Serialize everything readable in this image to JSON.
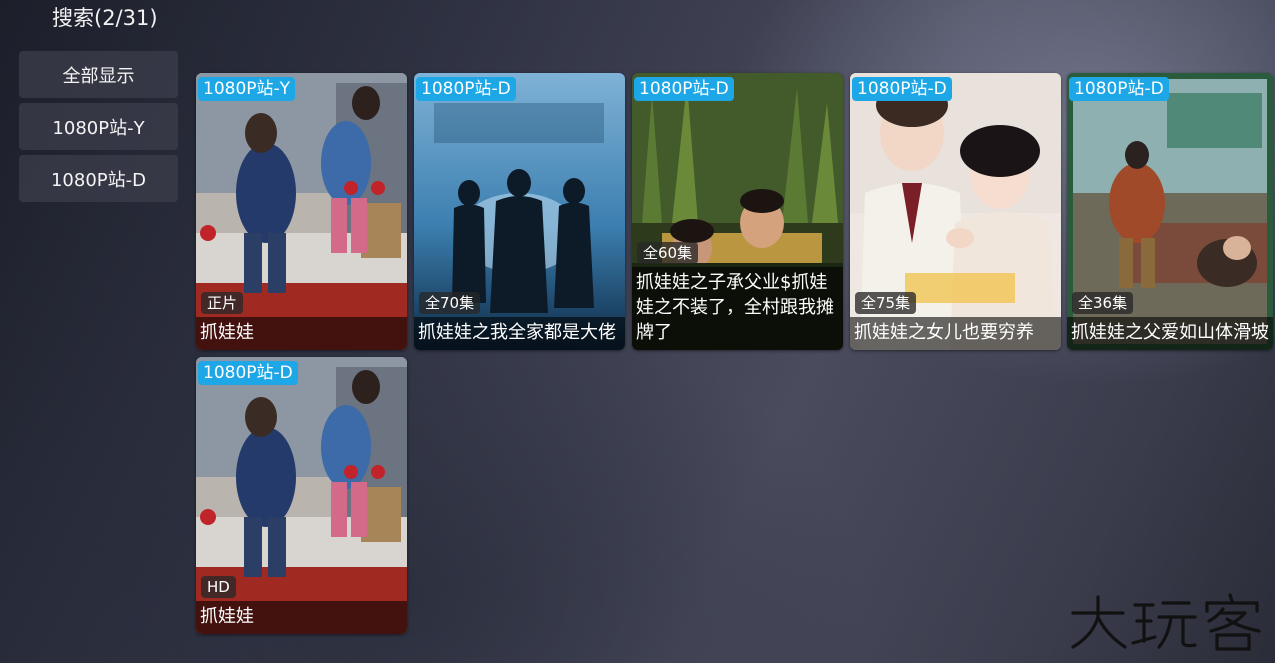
{
  "header": {
    "title": "搜索(2/31)"
  },
  "filters": [
    {
      "label": "全部显示"
    },
    {
      "label": "1080P站-Y"
    },
    {
      "label": "1080P站-D"
    }
  ],
  "results": [
    {
      "source": "1080P站-Y",
      "remark": "正片",
      "title": "抓娃娃"
    },
    {
      "source": "1080P站-D",
      "remark": "全70集",
      "title": "抓娃娃之我全家都是大佬"
    },
    {
      "source": "1080P站-D",
      "remark": "全60集",
      "title": "抓娃娃之子承父业$抓娃娃之不装了，全村跟我摊牌了"
    },
    {
      "source": "1080P站-D",
      "remark": "全75集",
      "title": "抓娃娃之女儿也要穷养"
    },
    {
      "source": "1080P站-D",
      "remark": "全36集",
      "title": "抓娃娃之父爱如山体滑坡"
    },
    {
      "source": "1080P站-D",
      "remark": "HD",
      "title": "抓娃娃"
    }
  ],
  "watermark": {
    "text": "大玩客",
    "icon": "brand-logo"
  },
  "colors": {
    "source_tag": "#1ea7e6",
    "filter_button": "#3c3e4c"
  }
}
